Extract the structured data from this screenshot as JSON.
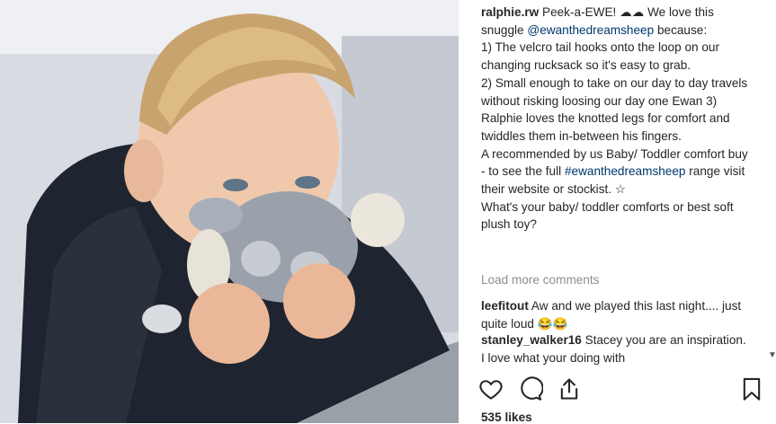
{
  "post": {
    "username": "ralphie.rw",
    "caption_intro": "Peek-a-EWE! ☁☁ We love this snuggle ",
    "mention": "@ewanthedreamsheep",
    "caption_after_mention": " because:",
    "point1": "1) The velcro tail hooks onto the loop on our changing rucksack so it's easy to grab.",
    "point2": "2) Small enough to take on our day to day travels without risking loosing our day one Ewan 3) Ralphie loves the knotted legs for comfort and twiddles them in-between his fingers.",
    "recommend_before": "A recommended by us Baby/ Toddler comfort buy - to see the full ",
    "hashtag": "#ewanthedreamsheep",
    "recommend_after": " range visit their website or stockist. ☆",
    "question": "What's your baby/ toddler comforts or best soft plush toy?"
  },
  "load_more_label": "Load more comments",
  "comments": [
    {
      "username": "leefitout",
      "text": "Aw and we played this last night.... just quite loud 😂😂"
    },
    {
      "username": "stanley_walker16",
      "text": "Stacey you are an inspiration. I love what your doing with"
    }
  ],
  "actions": {
    "like_icon": "heart-icon",
    "comment_icon": "comment-icon",
    "share_icon": "share-icon",
    "save_icon": "bookmark-icon"
  },
  "likes_label": "535 likes",
  "colors": {
    "link": "#00376b",
    "muted": "#8e8e8e",
    "text": "#262626"
  }
}
